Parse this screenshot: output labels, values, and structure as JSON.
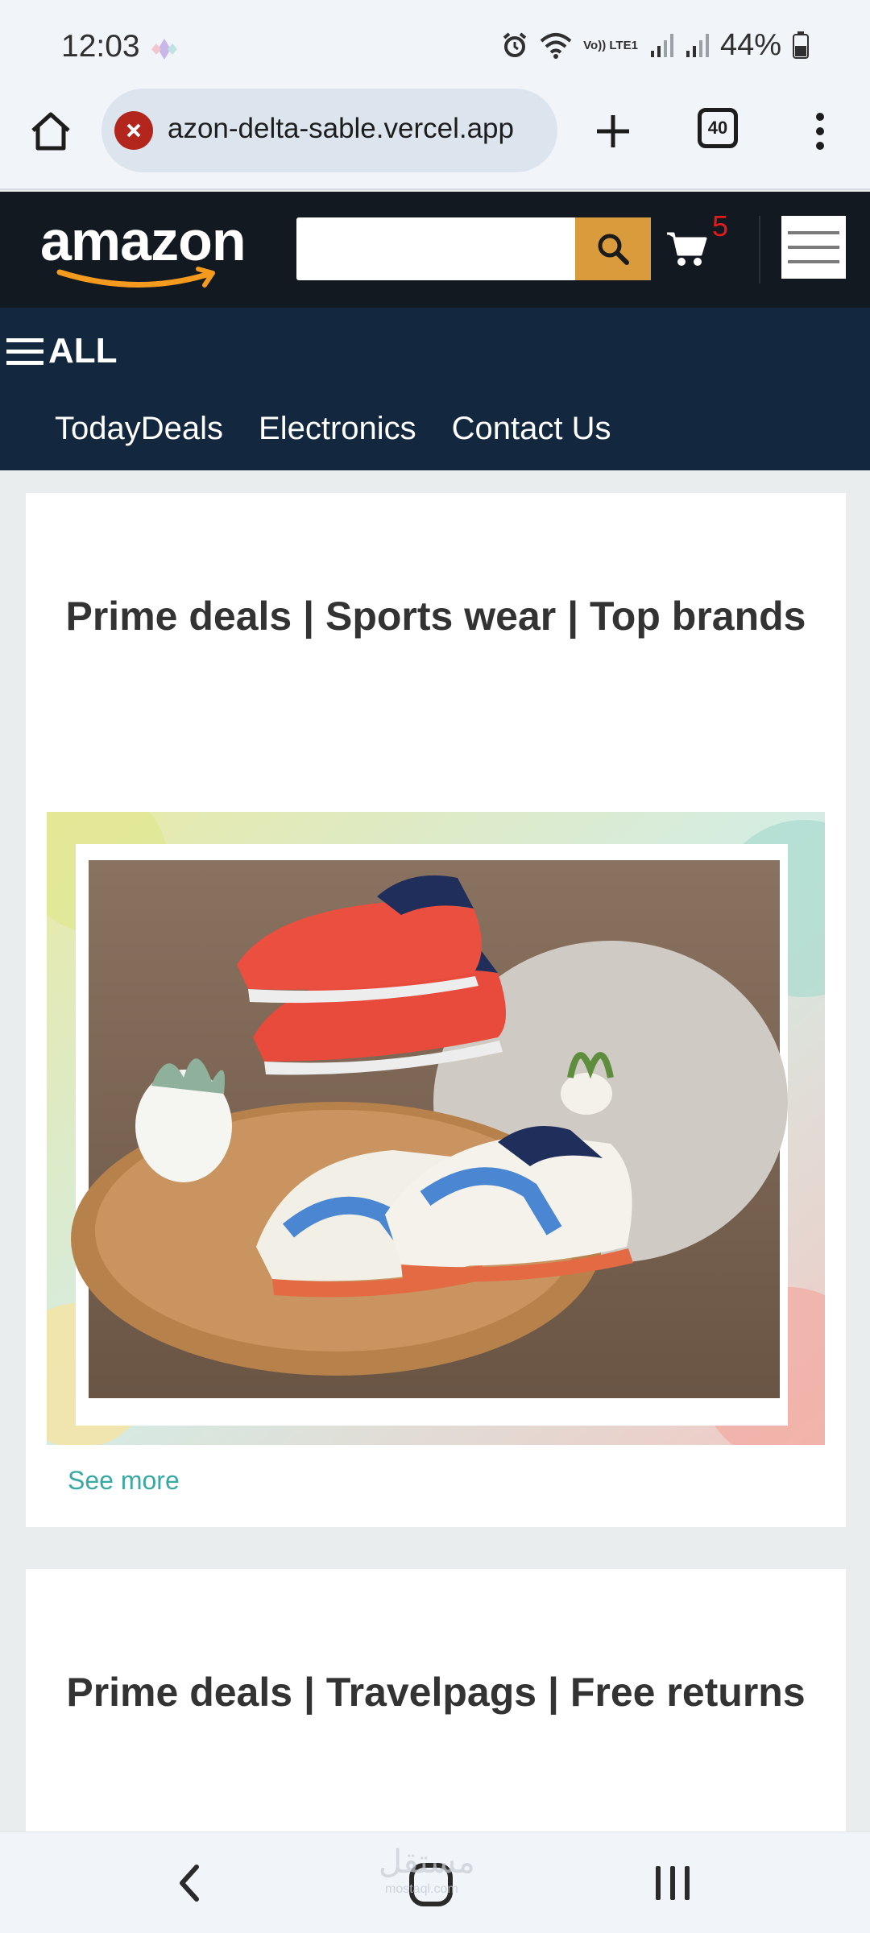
{
  "status_bar": {
    "time": "12:03",
    "network_label": "Vo)) LTE1",
    "battery": "44%"
  },
  "browser": {
    "url": "azon-delta-sable.vercel.app",
    "tab_count": "40",
    "error_icon": "close-icon"
  },
  "amazon_header": {
    "logo_text": "amazon",
    "search_placeholder": "",
    "search_value": "",
    "cart_count": "5",
    "colors": {
      "header_bg": "#131921",
      "search_button": "#d99b3c",
      "cart_count": "#e11b1b"
    }
  },
  "amazon_nav": {
    "all_label": "ALL",
    "links": [
      "TodayDeals",
      "Electronics",
      "Contact Us"
    ],
    "colors": {
      "nav_bg": "#13283f"
    }
  },
  "cards": [
    {
      "title": "Prime deals | Sports wear | Top brands",
      "see_more": "See more",
      "image": "sneakers-photo"
    },
    {
      "title": "Prime deals | Travelpags | Free returns"
    }
  ],
  "system_nav": {
    "watermark": "مستقل",
    "watermark_sub": "mostaql.com"
  }
}
